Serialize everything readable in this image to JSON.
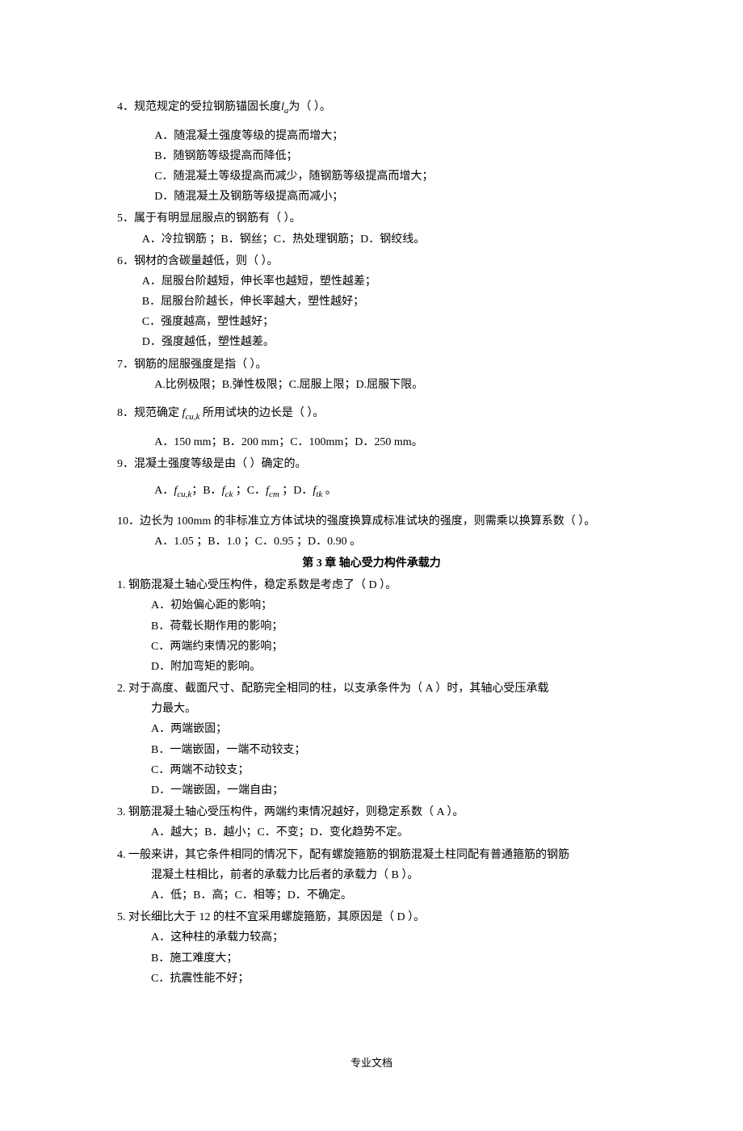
{
  "q4": {
    "text_a": "4．规范规定的受拉钢筋锚固长度",
    "var": "l",
    "subvar": "a",
    "text_b": "为（  ）。",
    "opts": {
      "a": "A．随混凝土强度等级的提高而增大；",
      "b": "B．随钢筋等级提高而降低；",
      "c": "C．随混凝土等级提高而减少，随钢筋等级提高而增大；",
      "d": "D．随混凝土及钢筋等级提高而减小；"
    }
  },
  "q5": {
    "text": "5．属于有明显屈服点的钢筋有（    ）。",
    "opts": "A．冷拉钢筋 ；B．钢丝；C．热处理钢筋；D．钢绞线。"
  },
  "q6": {
    "text": "6．钢材的含碳量越低，则（     ）。",
    "opts": {
      "a": "A．屈服台阶越短，伸长率也越短，塑性越差；",
      "b": "B．屈服台阶越长，伸长率越大，塑性越好；",
      "c": "C．强度越高，塑性越好；",
      "d": "D．强度越低，塑性越差。"
    }
  },
  "q7": {
    "text": "7．钢筋的屈服强度是指（   ）。",
    "opts": "A.比例极限；B.弹性极限；C.屈服上限；D.屈服下限。"
  },
  "q8": {
    "text_a": "8．规范确定",
    "var": "f",
    "subvar": "cu,k",
    "text_b": "所用试块的边长是（     ）。",
    "opts": "A．150 mm；B．200 mm；C．100mm；D．250 mm。"
  },
  "q9": {
    "text": "9．混凝土强度等级是由（     ）确定的。",
    "opts_a": "A．",
    "var1": "f",
    "sub1": "cu,k",
    "sep1": "；B．",
    "var2": "f",
    "sub2": "ck",
    "sep2": " ；C．",
    "var3": "f",
    "sub3": "cm",
    "sep3": " ；D．",
    "var4": "f",
    "sub4": "tk",
    "sep4": " 。"
  },
  "q10": {
    "text": "10．边长为 100mm 的非标准立方体试块的强度换算成标准试块的强度，则需乘以换算系数（ ）。",
    "opts": "A．1.05 ；B．1.0  ；C．0.95 ；D．0.90 。"
  },
  "chapter3_title": "第 3 章  轴心受力构件承载力",
  "c3q1": {
    "text": "1.        钢筋混凝土轴心受压构件，稳定系数是考虑了（   D   ）。",
    "opts": {
      "a": "A．初始偏心距的影响；",
      "b": "B．荷载长期作用的影响；",
      "c": "C．两端约束情况的影响；",
      "d": "D．附加弯矩的影响。"
    }
  },
  "c3q2": {
    "text": "2.        对于高度、截面尺寸、配筋完全相同的柱，以支承条件为（  A    ）时，其轴心受压承载",
    "text2": "力最大。",
    "opts": {
      "a": "A．两端嵌固；",
      "b": "B．一端嵌固，一端不动铰支；",
      "c": "C．两端不动铰支；",
      "d": "D．一端嵌固，一端自由；"
    }
  },
  "c3q3": {
    "text": "3.        钢筋混凝土轴心受压构件，两端约束情况越好，则稳定系数（   A   ）。",
    "opts": "A．越大；B．越小；C．不变；D．变化趋势不定。"
  },
  "c3q4": {
    "text": "4.        一般来讲，其它条件相同的情况下，配有螺旋箍筋的钢筋混凝土柱同配有普通箍筋的钢筋",
    "text2": "混凝土柱相比，前者的承载力比后者的承载力（   B    ）。",
    "opts": "A．低；B．高；C．相等；D．不确定。"
  },
  "c3q5": {
    "text": "5.        对长细比大于 12 的柱不宜采用螺旋箍筋，其原因是（    D  ）。",
    "opts": {
      "a": "A．这种柱的承载力较高；",
      "b": "B．施工难度大；",
      "c": "C．抗震性能不好；"
    }
  },
  "footer": "专业文档"
}
